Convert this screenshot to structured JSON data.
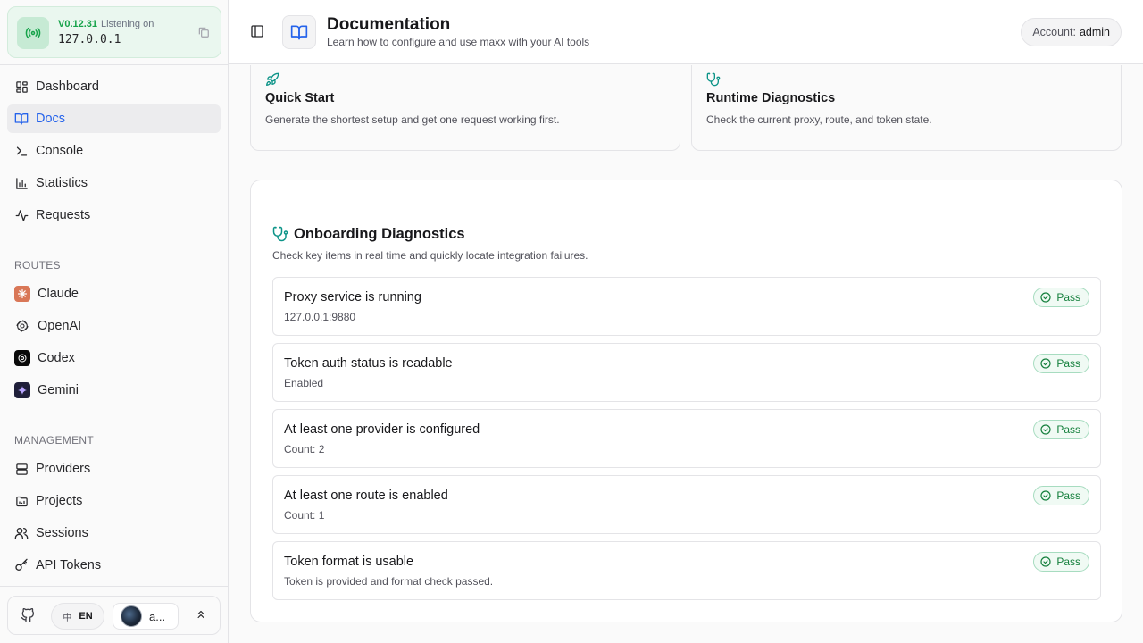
{
  "server": {
    "version": "V0.12.31",
    "listening_label": "Listening on",
    "address": "127.0.0.1"
  },
  "sidebar": {
    "nav": [
      {
        "label": "Dashboard",
        "icon": "dashboard-icon"
      },
      {
        "label": "Docs",
        "icon": "book-icon",
        "active": true
      },
      {
        "label": "Console",
        "icon": "terminal-icon"
      },
      {
        "label": "Statistics",
        "icon": "bar-chart-icon"
      },
      {
        "label": "Requests",
        "icon": "activity-icon"
      }
    ],
    "routes_label": "ROUTES",
    "routes": [
      {
        "label": "Claude",
        "icon": "claude-icon",
        "color": "#d97757"
      },
      {
        "label": "OpenAI",
        "icon": "openai-icon",
        "color": "#18181b"
      },
      {
        "label": "Codex",
        "icon": "codex-icon",
        "color": "#0a0a0a"
      },
      {
        "label": "Gemini",
        "icon": "gemini-icon",
        "color": "#1f1f3a"
      }
    ],
    "management_label": "MANAGEMENT",
    "management": [
      {
        "label": "Providers",
        "icon": "server-icon"
      },
      {
        "label": "Projects",
        "icon": "folder-icon"
      },
      {
        "label": "Sessions",
        "icon": "users-icon"
      },
      {
        "label": "API Tokens",
        "icon": "key-icon"
      }
    ],
    "footer": {
      "lang_zh": "中",
      "lang_en": "EN",
      "user_short": "a..."
    }
  },
  "header": {
    "title": "Documentation",
    "subtitle": "Learn how to configure and use maxx with your AI tools",
    "account_label": "Account:",
    "account_name": "admin"
  },
  "quick_cards": [
    {
      "title": "Quick Start",
      "desc": "Generate the shortest setup and get one request working first.",
      "icon": "rocket-icon"
    },
    {
      "title": "Runtime Diagnostics",
      "desc": "Check the current proxy, route, and token state.",
      "icon": "stethoscope-icon"
    }
  ],
  "diagnostics": {
    "title": "Onboarding Diagnostics",
    "desc": "Check key items in real time and quickly locate integration failures.",
    "checks": [
      {
        "label": "Proxy service is running",
        "detail": "127.0.0.1:9880",
        "status": "Pass"
      },
      {
        "label": "Token auth status is readable",
        "detail": "Enabled",
        "status": "Pass"
      },
      {
        "label": "At least one provider is configured",
        "detail": "Count: 2",
        "status": "Pass"
      },
      {
        "label": "At least one route is enabled",
        "detail": "Count: 1",
        "status": "Pass"
      },
      {
        "label": "Token format is usable",
        "detail": "Token is provided and format check passed.",
        "status": "Pass"
      }
    ]
  },
  "colors": {
    "accent": "#2563eb",
    "success": "#16a34a",
    "teal": "#0d9488"
  }
}
